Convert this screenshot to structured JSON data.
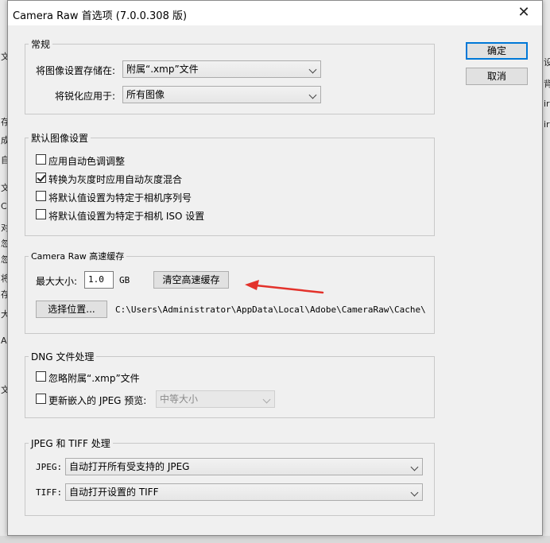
{
  "window": {
    "title": "Camera Raw 首选项 (7.0.0.308 版)"
  },
  "buttons": {
    "ok": "确定",
    "cancel": "取消"
  },
  "general": {
    "legend": "常规",
    "save_label": "将图像设置存储在:",
    "save_value": "附属“.xmp”文件",
    "sharpen_label": "将锐化应用于:",
    "sharpen_value": "所有图像"
  },
  "defaults": {
    "legend": "默认图像设置",
    "items": [
      {
        "label": "应用自动色调调整",
        "checked": false
      },
      {
        "label": "转换为灰度时应用自动灰度混合",
        "checked": true
      },
      {
        "label": "将默认值设置为特定于相机序列号",
        "checked": false
      },
      {
        "label": "将默认值设置为特定于相机 ISO 设置",
        "checked": false
      }
    ]
  },
  "cache": {
    "legend": "Camera Raw 高速缓存",
    "max_label": "最大大小:",
    "max_value": "1.0",
    "unit": "GB",
    "purge_button": "清空高速缓存",
    "location_button": "选择位置...",
    "path": "C:\\Users\\Administrator\\AppData\\Local\\Adobe\\CameraRaw\\Cache\\",
    "arrow_color": "#e3322b"
  },
  "dng": {
    "legend": "DNG 文件处理",
    "ignore_label": "忽略附属“.xmp”文件",
    "ignore_checked": false,
    "update_label": "更新嵌入的 JPEG 预览:",
    "update_checked": false,
    "preview_value": "中等大小"
  },
  "jpegtiff": {
    "legend": "JPEG 和 TIFF 处理",
    "jpeg_label": "JPEG:",
    "jpeg_value": "自动打开所有受支持的 JPEG",
    "tiff_label": "TIFF:",
    "tiff_value": "自动打开设置的 TIFF"
  },
  "background": {
    "left_fragments": [
      "文",
      "存",
      "成",
      "自",
      "文",
      "C",
      "对",
      "忽",
      "忽",
      "将",
      "存",
      "大",
      "A",
      "文"
    ],
    "right_fragments": [
      "设",
      "背",
      "ir",
      "ir"
    ]
  }
}
